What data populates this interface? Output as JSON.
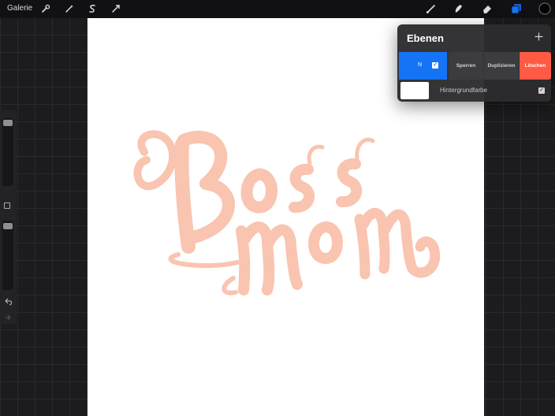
{
  "toolbar": {
    "gallery_label": "Galerie",
    "left_tools": [
      "wrench-icon",
      "magic-wand-icon",
      "selection-icon",
      "transform-icon"
    ],
    "right_tools": [
      "brush-icon",
      "smudge-icon",
      "eraser-icon",
      "layers-icon",
      "color-icon"
    ],
    "active_color": "#000000",
    "accent_color": "#1574f5"
  },
  "canvas": {
    "artwork_text": [
      "Boss",
      "mom"
    ],
    "artwork_color": "#f9c4b0",
    "paper_color": "#ffffff"
  },
  "sidebar": {
    "brush_size_level": 0.95,
    "opacity_level": 0.95,
    "icons": [
      "square-icon",
      "undo-icon",
      "redo-icon"
    ]
  },
  "layers_panel": {
    "title": "Ebenen",
    "add_icon": "plus-icon",
    "layer": {
      "blend_mode": "N",
      "visible": true,
      "actions": {
        "lock": "Sperren",
        "duplicate": "Duplizieren",
        "delete": "Löschen"
      },
      "delete_color": "#ff5a44"
    },
    "background": {
      "label": "Hintergrundfarbe",
      "visible": true,
      "color": "#ffffff"
    }
  }
}
